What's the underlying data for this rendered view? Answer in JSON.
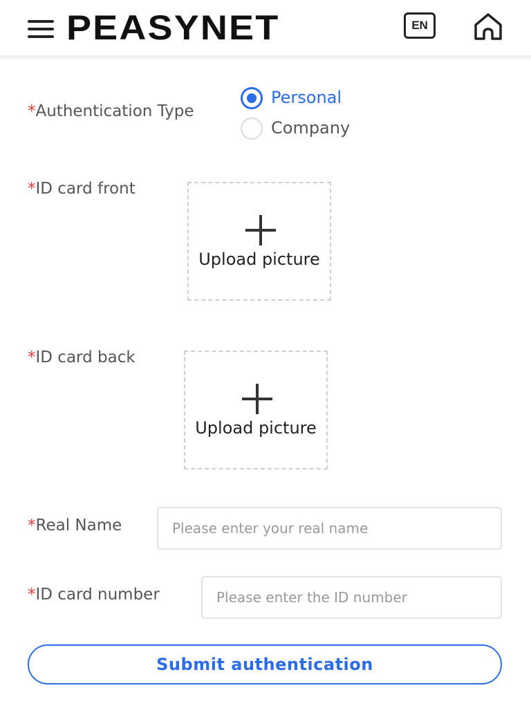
{
  "header": {
    "logo": "PEASYNET",
    "language": "EN",
    "icons": {
      "menu": "hamburger-menu-icon",
      "home": "home-icon"
    }
  },
  "form": {
    "required_mark": "*",
    "auth_type": {
      "label": "Authentication Type",
      "options": [
        "Personal",
        "Company"
      ],
      "selected": "Personal"
    },
    "id_front": {
      "label": "ID card front",
      "upload_text": "Upload picture"
    },
    "id_back": {
      "label": "ID card back",
      "upload_text": "Upload picture"
    },
    "real_name": {
      "label": "Real Name",
      "placeholder": "Please enter your real name",
      "value": ""
    },
    "id_number": {
      "label": "ID card number",
      "placeholder": "Please enter the ID number",
      "value": ""
    },
    "submit_label": "Submit authentication"
  },
  "colors": {
    "accent": "#2b6de9",
    "required": "#e53935",
    "label_text": "#555555"
  }
}
